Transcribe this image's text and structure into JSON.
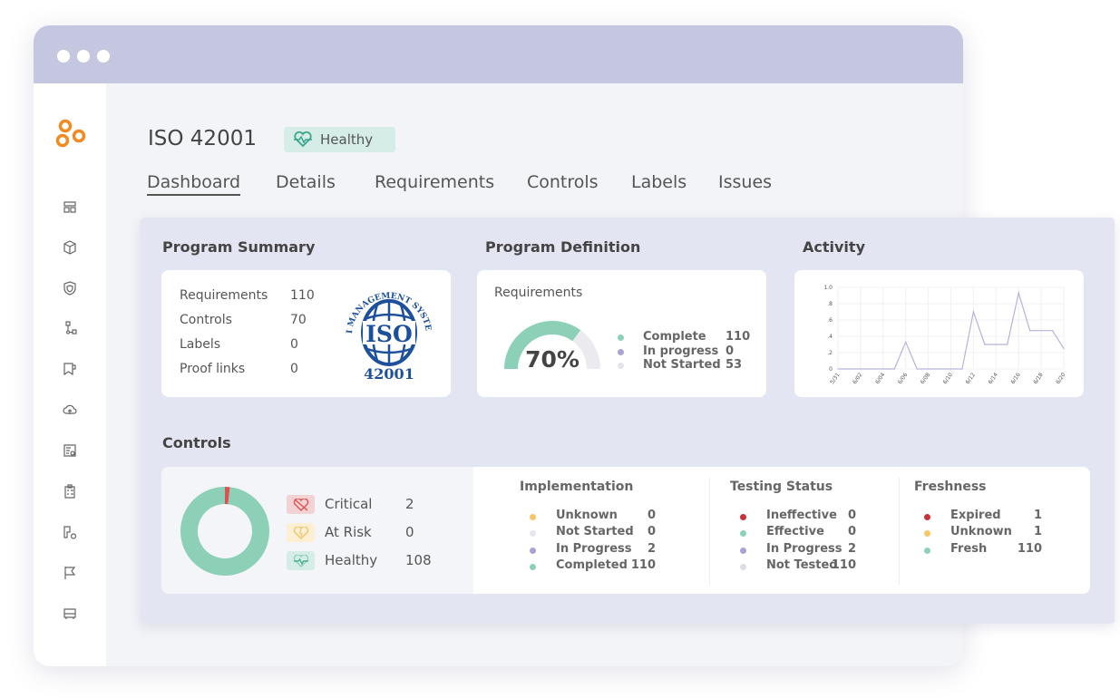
{
  "window": {
    "dots": 3
  },
  "sidebar": {
    "logo": "orange-rings-logo",
    "items": [
      {
        "icon": "dashboard-icon"
      },
      {
        "icon": "box-icon"
      },
      {
        "icon": "shield-icon"
      },
      {
        "icon": "workflow-icon"
      },
      {
        "icon": "bookmark-icon"
      },
      {
        "icon": "cloud-upload-icon"
      },
      {
        "icon": "report-search-icon"
      },
      {
        "icon": "clipboard-icon"
      },
      {
        "icon": "key-gear-icon"
      },
      {
        "icon": "flag-icon"
      },
      {
        "icon": "bus-icon"
      }
    ]
  },
  "header": {
    "title": "ISO 42001",
    "status": "Healthy",
    "status_color": "#d5ede6"
  },
  "tabs": [
    {
      "label": "Dashboard",
      "active": true
    },
    {
      "label": "Details"
    },
    {
      "label": "Requirements"
    },
    {
      "label": "Controls"
    },
    {
      "label": "Labels"
    },
    {
      "label": "Issues"
    }
  ],
  "program_summary": {
    "title": "Program Summary",
    "rows": [
      {
        "label": "Requirements",
        "value": "110"
      },
      {
        "label": "Controls",
        "value": "70"
      },
      {
        "label": "Labels",
        "value": "0"
      },
      {
        "label": "Proof links",
        "value": "0"
      }
    ],
    "logo_text": {
      "arc": "AI MANAGEMENT SYSTEM",
      "center": "ISO",
      "bottom": "42001"
    }
  },
  "program_definition": {
    "title": "Program Definition",
    "subtitle": "Requirements",
    "percent": "70%",
    "fraction": 0.7,
    "legend": [
      {
        "label": "Complete",
        "value": "110",
        "color": "#8dd0b8"
      },
      {
        "label": "In progress",
        "value": "0",
        "color": "#a9a3d3"
      },
      {
        "label": "Not Started",
        "value": "53",
        "color": "#e3e3e8"
      }
    ]
  },
  "activity": {
    "title": "Activity"
  },
  "chart_data": {
    "type": "line",
    "title": "",
    "xlabel": "",
    "ylabel": "",
    "ylim": [
      0,
      1.0
    ],
    "grid": true,
    "yticks": [
      "0",
      ".2",
      ".4",
      ".6",
      ".8",
      "1.0"
    ],
    "xticks": [
      "5/31",
      "6/02",
      "6/04",
      "6/06",
      "6/08",
      "6/10",
      "6/12",
      "6/14",
      "6/16",
      "6/18",
      "6/20"
    ],
    "x": [
      "5/31",
      "6/01",
      "6/02",
      "6/03",
      "6/04",
      "6/05",
      "6/06",
      "6/07",
      "6/08",
      "6/09",
      "6/10",
      "6/11",
      "6/12",
      "6/13",
      "6/14",
      "6/15",
      "6/16",
      "6/17",
      "6/18",
      "6/19",
      "6/20"
    ],
    "values": [
      0,
      0,
      0,
      0,
      0,
      0,
      0.33,
      0,
      0,
      0,
      0,
      0,
      0.7,
      0.3,
      0.3,
      0.3,
      0.93,
      0.47,
      0.47,
      0.47,
      0.25
    ],
    "color": "#b5b3dc"
  },
  "controls": {
    "title": "Controls",
    "health": [
      {
        "label": "Critical",
        "value": "2",
        "color": "#e05050",
        "bg": "#f2d2d2",
        "icon": "broken-heart-icon"
      },
      {
        "label": "At Risk",
        "value": "0",
        "color": "#f1c46c",
        "bg": "#fdefd3",
        "icon": "heart-crack-icon"
      },
      {
        "label": "Healthy",
        "value": "108",
        "color": "#8dd0b8",
        "bg": "#d5ede6",
        "icon": "heartbeat-icon"
      }
    ],
    "groups": [
      {
        "title": "Implementation",
        "items": [
          {
            "label": "Unknown",
            "value": "0",
            "color": "#f7c667"
          },
          {
            "label": "Not Started",
            "value": "0",
            "color": "#e6e6ec"
          },
          {
            "label": "In Progress",
            "value": "2",
            "color": "#a9a3d3"
          },
          {
            "label": "Completed",
            "value": "110",
            "color": "#8dd0b8"
          }
        ]
      },
      {
        "title": "Testing Status",
        "items": [
          {
            "label": "Ineffective",
            "value": "0",
            "color": "#c8303a"
          },
          {
            "label": "Effective",
            "value": "0",
            "color": "#8dd0b8"
          },
          {
            "label": "In Progress",
            "value": "2",
            "color": "#a9a3d3"
          },
          {
            "label": "Not Tested",
            "value": "110",
            "color": "#dcdce2"
          }
        ]
      },
      {
        "title": "Freshness",
        "items": [
          {
            "label": "Expired",
            "value": "1",
            "color": "#c8303a"
          },
          {
            "label": "Unknown",
            "value": "1",
            "color": "#f7c667"
          },
          {
            "label": "Fresh",
            "value": "110",
            "color": "#8dd0b8"
          }
        ]
      }
    ]
  }
}
